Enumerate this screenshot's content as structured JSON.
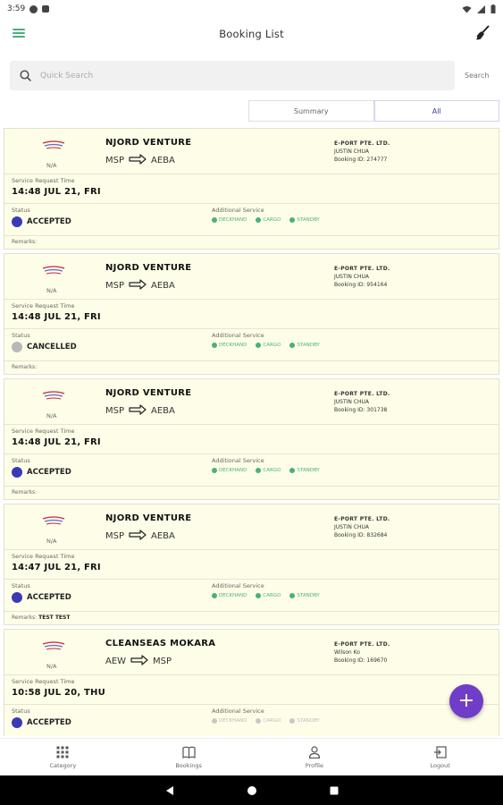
{
  "status_bar": {
    "time": "3:59"
  },
  "app_bar": {
    "title": "Booking List"
  },
  "search": {
    "placeholder": "Quick Search",
    "button_label": "Search"
  },
  "tabs": [
    {
      "label": "Summary",
      "active": false
    },
    {
      "label": "All",
      "active": true
    }
  ],
  "labels": {
    "service_request_time": "Service Request Time",
    "status": "Status",
    "additional_service": "Additional Service",
    "remarks": "Remarks:",
    "logo_caption": "N/A"
  },
  "services": [
    "DECKHAND",
    "CARGO",
    "STANDBY"
  ],
  "bookings": [
    {
      "vessel": "NJORD VENTURE",
      "from": "MSP",
      "to": "AEBA",
      "company": "E-PORT PTE. LTD.",
      "person": "JUSTIN CHUA",
      "booking_id": "Booking ID: 274777",
      "time": "14:48 JUL 21, FRI",
      "status": "ACCEPTED",
      "status_color": "#3a3ab5",
      "remarks": "",
      "services_active": true
    },
    {
      "vessel": "NJORD VENTURE",
      "from": "MSP",
      "to": "AEBA",
      "company": "E-PORT PTE. LTD.",
      "person": "JUSTIN CHUA",
      "booking_id": "Booking ID: 954164",
      "time": "14:48 JUL 21, FRI",
      "status": "CANCELLED",
      "status_color": "#b8b8b8",
      "remarks": "",
      "services_active": true
    },
    {
      "vessel": "NJORD VENTURE",
      "from": "MSP",
      "to": "AEBA",
      "company": "E-PORT PTE. LTD.",
      "person": "JUSTIN CHUA",
      "booking_id": "Booking ID: 301738",
      "time": "14:48 JUL 21, FRI",
      "status": "ACCEPTED",
      "status_color": "#3a3ab5",
      "remarks": "",
      "services_active": true
    },
    {
      "vessel": "NJORD VENTURE",
      "from": "MSP",
      "to": "AEBA",
      "company": "E-PORT PTE. LTD.",
      "person": "JUSTIN CHUA",
      "booking_id": "Booking ID: 832684",
      "time": "14:47 JUL 21, FRI",
      "status": "ACCEPTED",
      "status_color": "#3a3ab5",
      "remarks": "TEST TEST",
      "services_active": true
    },
    {
      "vessel": "CLEANSEAS MOKARA",
      "from": "AEW",
      "to": "MSP",
      "company": "E-PORT PTE. LTD.",
      "person": "Wilson Ko",
      "booking_id": "Booking ID: 169670",
      "time": "10:58 JUL 20, THU",
      "status": "ACCEPTED",
      "status_color": "#3a3ab5",
      "remarks": "",
      "services_active": false
    }
  ],
  "bottom_nav": [
    {
      "label": "Category",
      "icon": "grid-icon"
    },
    {
      "label": "Bookings",
      "icon": "book-icon"
    },
    {
      "label": "Profile",
      "icon": "person-icon"
    },
    {
      "label": "Logout",
      "icon": "logout-icon"
    }
  ],
  "colors": {
    "accent": "#6f3dc8",
    "service_green": "#4caf7d",
    "card_bg": "#fefee8"
  }
}
